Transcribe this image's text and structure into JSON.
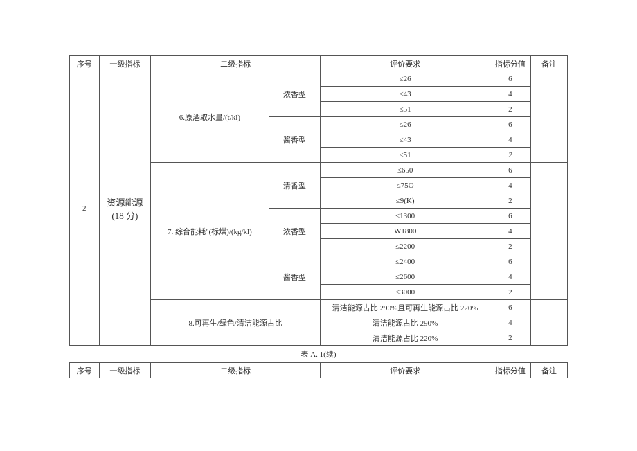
{
  "headers": {
    "seq": "序号",
    "level1": "一级指标",
    "level2": "二级指标",
    "requirement": "评价要求",
    "score": "指标分值",
    "note": "备注"
  },
  "main": {
    "seq": "2",
    "level1_line1": "资源能源",
    "level1_line2": "(18 分)",
    "sections": {
      "s6": {
        "title": "6.原酒取水量/(t/kl)",
        "groups": [
          {
            "name": "浓香型",
            "rows": [
              {
                "req": "≤26",
                "score": "6"
              },
              {
                "req": "≤43",
                "score": "4"
              },
              {
                "req": "≤51",
                "score": "2"
              }
            ]
          },
          {
            "name": "酱香型",
            "rows": [
              {
                "req": "≤26",
                "score": "6"
              },
              {
                "req": "≤43",
                "score": "4"
              },
              {
                "req": "≤51",
                "score": "2",
                "italic": true
              }
            ]
          }
        ]
      },
      "s7": {
        "title": "7. 综合能耗\"(标煤)/(kg/kl)",
        "groups": [
          {
            "name": "清香型",
            "rows": [
              {
                "req": "≤650",
                "score": "6"
              },
              {
                "req": "≤75O",
                "score": "4"
              },
              {
                "req": "≤9(K)",
                "score": "2"
              }
            ]
          },
          {
            "name": "浓香型",
            "rows": [
              {
                "req": "≤1300",
                "score": "6"
              },
              {
                "req": "W1800",
                "score": "4"
              },
              {
                "req": "≤2200",
                "score": "2"
              }
            ]
          },
          {
            "name": "酱香型",
            "rows": [
              {
                "req": "≤2400",
                "score": "6"
              },
              {
                "req": "≤2600",
                "score": "4"
              },
              {
                "req": "≤3000",
                "score": "2"
              }
            ]
          }
        ]
      },
      "s8": {
        "title": "8.可再生/绿色/清洁能源占比",
        "rows": [
          {
            "req": "清洁能源占比 290%且可再生能源占比 220%",
            "score": "6"
          },
          {
            "req": "清洁能源占比 290%",
            "score": "4"
          },
          {
            "req": "清洁能源占比 220%",
            "score": "2"
          }
        ]
      }
    }
  },
  "caption": "表 A. 1(续)"
}
